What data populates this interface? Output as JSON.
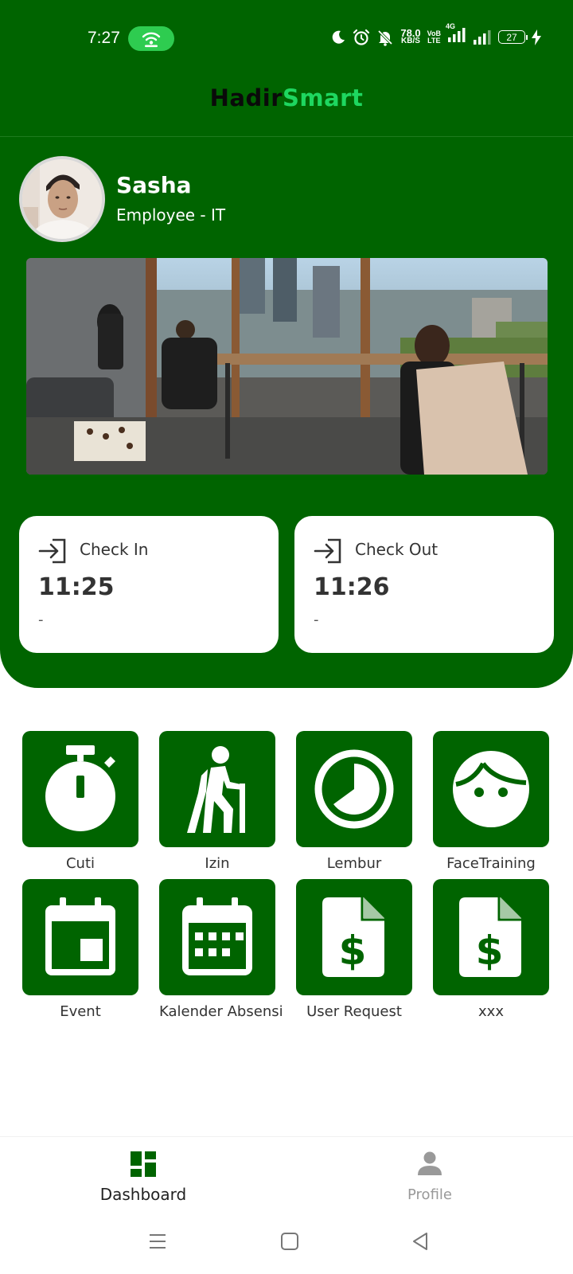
{
  "status_bar": {
    "time": "7:27",
    "net_speed_value": "78.0",
    "net_speed_unit": "KB/S",
    "volte_top": "VoB",
    "volte_bottom": "LTE",
    "network_type": "4G",
    "battery_level": "27",
    "icons": [
      "hotspot-icon",
      "moon-icon",
      "alarm-icon",
      "mute-bell-icon",
      "signal-icon",
      "signal-icon",
      "charging-icon"
    ]
  },
  "app": {
    "title_part1": "Hadir",
    "title_part2": "Smart",
    "brand_color": "#006400",
    "accent_color": "#1ed760"
  },
  "user": {
    "name": "Sasha",
    "role": "Employee - IT"
  },
  "check_in": {
    "label": "Check In",
    "time": "11:25",
    "note": "-"
  },
  "check_out": {
    "label": "Check Out",
    "time": "11:26",
    "note": "-"
  },
  "menu": [
    {
      "label": "Cuti",
      "icon": "stopwatch-icon"
    },
    {
      "label": "Izin",
      "icon": "hiker-icon"
    },
    {
      "label": "Lembur",
      "icon": "clock-pie-icon"
    },
    {
      "label": "FaceTraining",
      "icon": "face-icon"
    },
    {
      "label": "Event",
      "icon": "calendar-event-icon"
    },
    {
      "label": "Kalender Absensi",
      "icon": "calendar-grid-icon"
    },
    {
      "label": "User Request",
      "icon": "invoice-dollar-icon"
    },
    {
      "label": "xxx",
      "icon": "invoice-dollar-icon"
    }
  ],
  "bottom_nav": {
    "dashboard": "Dashboard",
    "profile": "Profile",
    "active": "Dashboard"
  }
}
